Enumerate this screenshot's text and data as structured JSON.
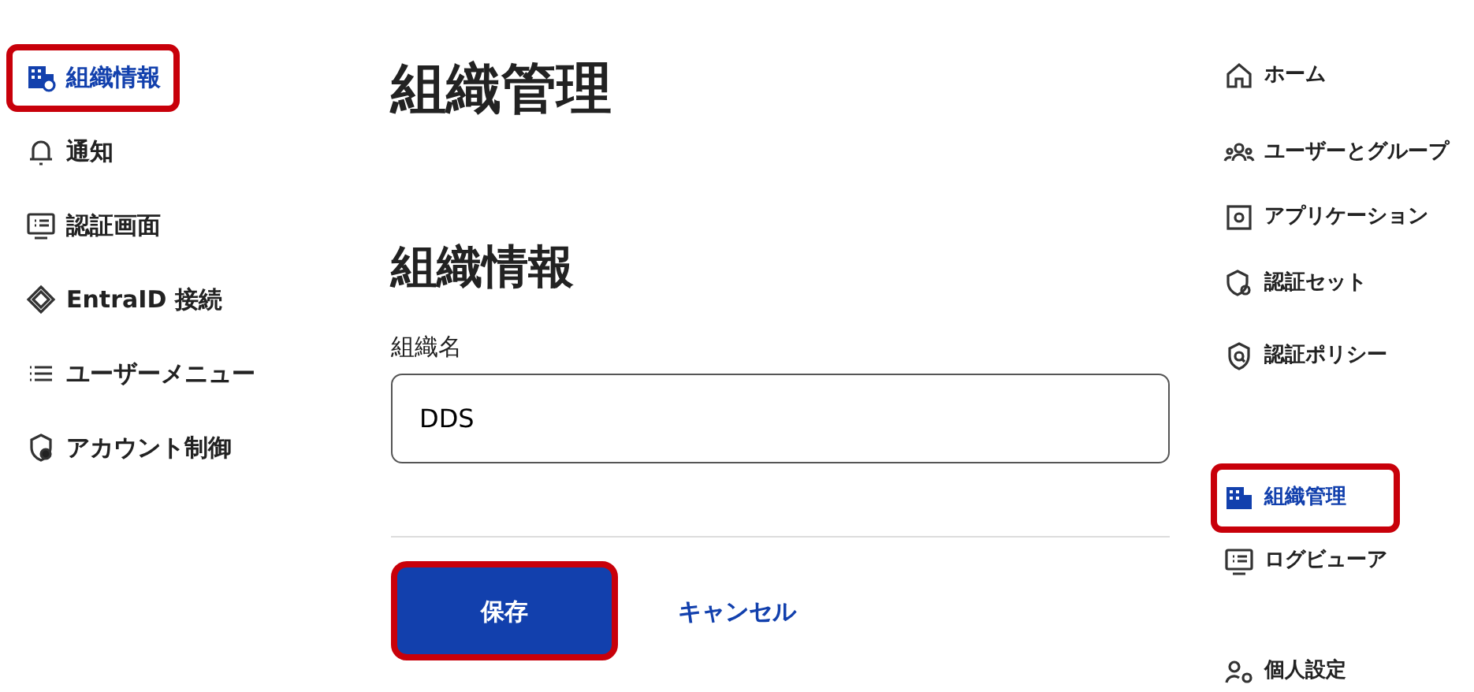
{
  "left_nav": {
    "items": [
      {
        "label": "組織情報",
        "selected": true,
        "highlighted": true
      },
      {
        "label": "通知",
        "selected": false,
        "highlighted": false
      },
      {
        "label": "認証画面",
        "selected": false,
        "highlighted": false
      },
      {
        "label": "EntraID 接続",
        "selected": false,
        "highlighted": false
      },
      {
        "label": "ユーザーメニュー",
        "selected": false,
        "highlighted": false
      },
      {
        "label": "アカウント制御",
        "selected": false,
        "highlighted": false
      }
    ]
  },
  "main": {
    "title": "組織管理",
    "section_title": "組織情報",
    "field": {
      "label": "組織名",
      "value": "DDS"
    },
    "buttons": [
      {
        "label": "保存",
        "kind": "primary",
        "highlighted": true
      },
      {
        "label": "キャンセル",
        "kind": "link",
        "highlighted": false
      }
    ]
  },
  "right_nav": {
    "items": [
      {
        "label": "ホーム",
        "selected": false,
        "highlighted": false
      },
      {
        "label": "ユーザーとグループ",
        "selected": false,
        "highlighted": false
      },
      {
        "label": "アプリケーション",
        "selected": false,
        "highlighted": false
      },
      {
        "label": "認証セット",
        "selected": false,
        "highlighted": false
      },
      {
        "label": "認証ポリシー",
        "selected": false,
        "highlighted": false
      },
      {
        "label": "組織管理",
        "selected": true,
        "highlighted": true
      },
      {
        "label": "ログビューア",
        "selected": false,
        "highlighted": false
      },
      {
        "label": "個人設定",
        "selected": false,
        "highlighted": false
      }
    ]
  }
}
